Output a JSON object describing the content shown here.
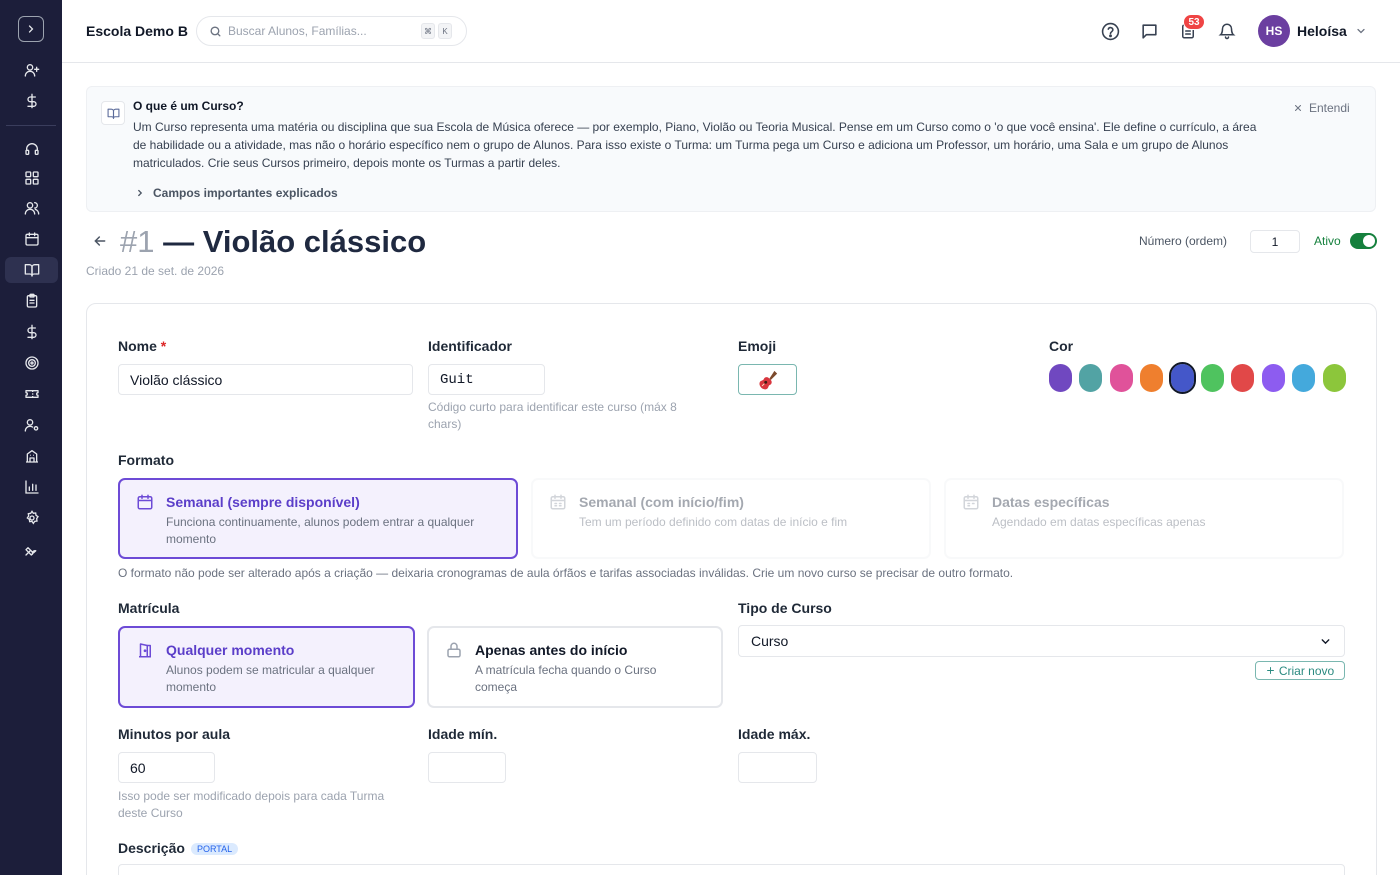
{
  "topbar": {
    "school_name": "Escola Demo B",
    "search_placeholder": "Buscar Alunos, Famílias...",
    "kbd_cmd": "⌘",
    "kbd_key": "K",
    "notification_count": "53",
    "user_initials": "HS",
    "user_name": "Heloísa"
  },
  "sidebar": {
    "icons": [
      "user-plus-icon",
      "dollar-icon",
      "headset-icon",
      "grid-icon",
      "users-icon",
      "calendar-icon",
      "book-open-icon",
      "clipboard-icon",
      "dollar-icon",
      "target-icon",
      "ticket-icon",
      "user-cog-icon",
      "building-icon",
      "bar-chart-icon",
      "gear-icon",
      "wrench-icon"
    ],
    "active": "book-open-icon"
  },
  "info": {
    "title": "O que é um Curso?",
    "text": "Um Curso representa uma matéria ou disciplina que sua Escola de Música oferece — por exemplo, Piano, Violão ou Teoria Musical. Pense em um Curso como o 'o que você ensina'. Ele define o currículo, a área de habilidade ou a atividade, mas não o horário específico nem o grupo de Alunos. Para isso existe o Turma: um Turma pega um Curso e adiciona um Professor, um horário, uma Sala e um grupo de Alunos matriculados. Crie seus Cursos primeiro, depois monte os Turmas a partir deles.",
    "more": "Campos importantes explicados",
    "dismiss": "Entendi"
  },
  "header": {
    "number": "#1",
    "title": "— Violão clássico",
    "created": "Criado 21 de set. de 2026",
    "order_label": "Número (ordem)",
    "order_value": "1",
    "active_label": "Ativo",
    "active": true
  },
  "form": {
    "name_label": "Nome",
    "name_required": "*",
    "name_value": "Violão clássico",
    "id_label": "Identificador",
    "id_value": "Guit",
    "id_hint": "Código curto para identificar este curso (máx 8 chars)",
    "emoji_label": "Emoji",
    "emoji_value": "🎸",
    "color_label": "Cor",
    "colors": [
      "#7048c0",
      "#52a3a4",
      "#e0529a",
      "#ef7f2e",
      "#4457c9",
      "#4fc35f",
      "#e14848",
      "#8d5cf0",
      "#44a9dc",
      "#8cc63b"
    ],
    "selected_color": "#4457c9",
    "format_label": "Formato",
    "format_options": [
      {
        "title": "Semanal (sempre disponível)",
        "desc": "Funciona continuamente, alunos podem entrar a qualquer momento",
        "selected": true
      },
      {
        "title": "Semanal (com início/fim)",
        "desc": "Tem um período definido com datas de início e fim",
        "selected": false
      },
      {
        "title": "Datas específicas",
        "desc": "Agendado em datas específicas apenas",
        "selected": false
      }
    ],
    "format_note": "O formato não pode ser alterado após a criação — deixaria cronogramas de aula órfãos e tarifas associadas inválidas. Crie um novo curso se precisar de outro formato.",
    "enroll_label": "Matrícula",
    "enroll_options": [
      {
        "title": "Qualquer momento",
        "desc": "Alunos podem se matricular a qualquer momento",
        "selected": true
      },
      {
        "title": "Apenas antes do início",
        "desc": "A matrícula fecha quando o Curso começa",
        "selected": false
      }
    ],
    "type_label": "Tipo de Curso",
    "type_value": "Curso",
    "create_new": "Criar novo",
    "minutes_label": "Minutos por aula",
    "minutes_value": "60",
    "minutes_hint": "Isso pode ser modificado depois para cada Turma deste Curso",
    "min_age_label": "Idade mín.",
    "max_age_label": "Idade máx.",
    "desc_label": "Descrição",
    "desc_badge": "PORTAL"
  }
}
